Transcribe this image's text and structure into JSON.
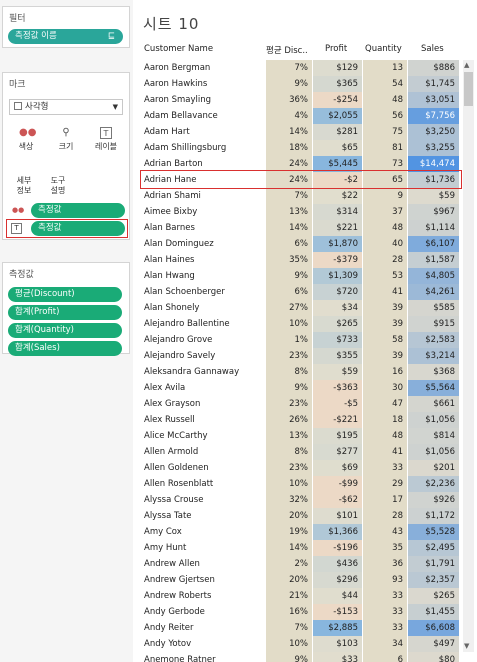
{
  "filters": {
    "title": "필터",
    "pill": "측정값 이름"
  },
  "marks": {
    "title": "마크",
    "type_select": "사각형",
    "buttons": [
      "색상",
      "크기",
      "레이블",
      "세부\n정보",
      "도구\n설명"
    ],
    "encodings": [
      "측정값",
      "측정값"
    ]
  },
  "measure_values": {
    "title": "측정값",
    "items": [
      "평균(Discount)",
      "합계(Profit)",
      "합계(Quantity)",
      "합계(Sales)"
    ]
  },
  "sheet": {
    "title": "시트 10",
    "columns": [
      "Customer Name",
      "평균 Disc..",
      "Profit",
      "Quantity",
      "Sales"
    ],
    "highlighted_row": "Adrian Hane",
    "rows": [
      [
        "Aaron Bergman",
        "7%",
        "$129",
        "13",
        "$886"
      ],
      [
        "Aaron Hawkins",
        "9%",
        "$365",
        "54",
        "$1,745"
      ],
      [
        "Aaron Smayling",
        "36%",
        "-$254",
        "48",
        "$3,051"
      ],
      [
        "Adam Bellavance",
        "4%",
        "$2,055",
        "56",
        "$7,756"
      ],
      [
        "Adam Hart",
        "14%",
        "$281",
        "75",
        "$3,250"
      ],
      [
        "Adam Shillingsburg",
        "18%",
        "$65",
        "81",
        "$3,255"
      ],
      [
        "Adrian Barton",
        "24%",
        "$5,445",
        "73",
        "$14,474"
      ],
      [
        "Adrian Hane",
        "24%",
        "-$2",
        "65",
        "$1,736"
      ],
      [
        "Adrian Shami",
        "7%",
        "$22",
        "9",
        "$59"
      ],
      [
        "Aimee Bixby",
        "13%",
        "$314",
        "37",
        "$967"
      ],
      [
        "Alan Barnes",
        "14%",
        "$221",
        "48",
        "$1,114"
      ],
      [
        "Alan Dominguez",
        "6%",
        "$1,870",
        "40",
        "$6,107"
      ],
      [
        "Alan Haines",
        "35%",
        "-$379",
        "28",
        "$1,587"
      ],
      [
        "Alan Hwang",
        "9%",
        "$1,309",
        "53",
        "$4,805"
      ],
      [
        "Alan Schoenberger",
        "6%",
        "$720",
        "41",
        "$4,261"
      ],
      [
        "Alan Shonely",
        "27%",
        "$34",
        "39",
        "$585"
      ],
      [
        "Alejandro Ballentine",
        "10%",
        "$265",
        "39",
        "$915"
      ],
      [
        "Alejandro Grove",
        "1%",
        "$733",
        "58",
        "$2,583"
      ],
      [
        "Alejandro Savely",
        "23%",
        "$355",
        "39",
        "$3,214"
      ],
      [
        "Aleksandra Gannaway",
        "8%",
        "$59",
        "16",
        "$368"
      ],
      [
        "Alex Avila",
        "9%",
        "-$363",
        "30",
        "$5,564"
      ],
      [
        "Alex Grayson",
        "23%",
        "-$5",
        "47",
        "$661"
      ],
      [
        "Alex Russell",
        "26%",
        "-$221",
        "18",
        "$1,056"
      ],
      [
        "Alice McCarthy",
        "13%",
        "$195",
        "48",
        "$814"
      ],
      [
        "Allen Armold",
        "8%",
        "$277",
        "41",
        "$1,056"
      ],
      [
        "Allen Goldenen",
        "23%",
        "$69",
        "33",
        "$201"
      ],
      [
        "Allen Rosenblatt",
        "10%",
        "-$99",
        "29",
        "$2,236"
      ],
      [
        "Alyssa Crouse",
        "32%",
        "-$62",
        "17",
        "$926"
      ],
      [
        "Alyssa Tate",
        "20%",
        "$101",
        "28",
        "$1,172"
      ],
      [
        "Amy Cox",
        "19%",
        "$1,366",
        "43",
        "$5,528"
      ],
      [
        "Amy Hunt",
        "14%",
        "-$196",
        "35",
        "$2,495"
      ],
      [
        "Andrew Allen",
        "2%",
        "$436",
        "36",
        "$1,791"
      ],
      [
        "Andrew Gjertsen",
        "20%",
        "$296",
        "93",
        "$2,357"
      ],
      [
        "Andrew Roberts",
        "21%",
        "$44",
        "33",
        "$265"
      ],
      [
        "Andy Gerbode",
        "16%",
        "-$153",
        "33",
        "$1,455"
      ],
      [
        "Andy Reiter",
        "7%",
        "$2,885",
        "33",
        "$6,608"
      ],
      [
        "Andy Yotov",
        "10%",
        "$103",
        "34",
        "$497"
      ],
      [
        "Anemone Ratner",
        "9%",
        "$33",
        "6",
        "$80"
      ]
    ]
  },
  "colors": {
    "pill": "#1aab77",
    "filter_pill": "#2aa69a",
    "highlight": "#d9302f",
    "disc_bg": "#e2dcc8"
  }
}
